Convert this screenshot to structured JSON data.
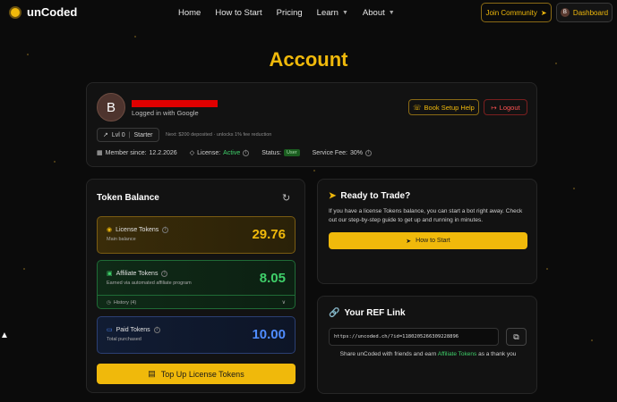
{
  "brand": {
    "name": "unCoded"
  },
  "nav": {
    "links": [
      "Home",
      "How to Start",
      "Pricing",
      "Learn",
      "About"
    ],
    "join_community": "Join Community",
    "dashboard": "Dashboard",
    "dashboard_avatar": "B"
  },
  "page": {
    "title": "Account"
  },
  "profile": {
    "avatar_letter": "B",
    "logged_in": "Logged in with Google",
    "setup_help": "Book Setup Help",
    "logout": "Logout",
    "level": "Lvl 0",
    "tier": "Starter",
    "next_note": "Next: $200 deposited · unlocks 1% fee reduction",
    "member_since_label": "Member since:",
    "member_since": "12.2.2026",
    "license_label": "License:",
    "license_value": "Active",
    "status_label": "Status:",
    "status_value": "User",
    "fee_label": "Service Fee:",
    "fee_value": "30%"
  },
  "tokens": {
    "title": "Token Balance",
    "license": {
      "name": "License Tokens",
      "sub": "Main balance",
      "value": "29.76",
      "color": "#f0b90b"
    },
    "affiliate": {
      "name": "Affiliate Tokens",
      "sub": "Earned via automated affiliate program",
      "value": "8.05",
      "color": "#3fd06a",
      "history": "History (4)"
    },
    "paid": {
      "name": "Paid Tokens",
      "sub": "Total purchased",
      "value": "10.00",
      "color": "#4f8cff"
    },
    "topup": "Top Up License Tokens"
  },
  "ready": {
    "title": "Ready to Trade?",
    "text": "If you have a license Tokens balance, you can start a bot right away. Check out our step-by-step guide to get up and running in minutes.",
    "button": "How to Start"
  },
  "ref": {
    "title": "Your REF Link",
    "link": "https://uncoded.ch/?id=1180205266309228896",
    "share_prefix": "Share unCoded with friends and earn",
    "share_highlight": "Affiliate Tokens",
    "share_suffix": "as a thank you"
  }
}
